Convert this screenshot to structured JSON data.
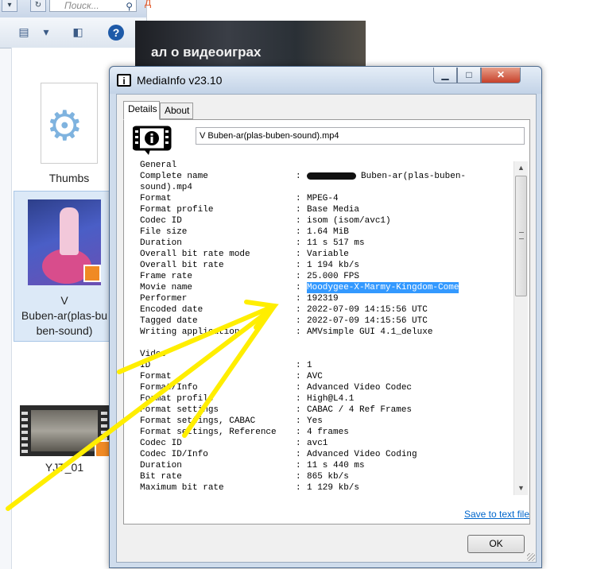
{
  "explorer": {
    "search_placeholder": "Поиск...",
    "files": [
      {
        "label": "Thumbs"
      },
      {
        "label": "V Buben-ar(plas-buben-sound)",
        "line1": "V",
        "line2": "Buben-ar(plas-bu",
        "line3": "ben-sound)"
      },
      {
        "label": "YJT_01"
      }
    ]
  },
  "background": {
    "banner_text": "ал о видеоиграх",
    "red_mark": "д"
  },
  "window": {
    "title": "MediaInfo v23.10",
    "tabs": [
      "Details",
      "About"
    ],
    "file_name": "V Buben-ar(plas-buben-sound).mp4",
    "save_link": "Save to text file",
    "ok_label": "OK"
  },
  "report": {
    "rows": [
      {
        "key": "General",
        "value": null
      },
      {
        "key": "Complete name",
        "value": "Buben-ar(plas-buben-",
        "redacted": true
      },
      {
        "key": "sound).mp4",
        "value": null,
        "continuation": true
      },
      {
        "key": "Format",
        "value": "MPEG-4"
      },
      {
        "key": "Format profile",
        "value": "Base Media"
      },
      {
        "key": "Codec ID",
        "value": "isom (isom/avc1)"
      },
      {
        "key": "File size",
        "value": "1.64 MiB"
      },
      {
        "key": "Duration",
        "value": "11 s 517 ms"
      },
      {
        "key": "Overall bit rate mode",
        "value": "Variable"
      },
      {
        "key": "Overall bit rate",
        "value": "1 194 kb/s"
      },
      {
        "key": "Frame rate",
        "value": "25.000 FPS"
      },
      {
        "key": "Movie name",
        "value": "Moodygee-X-Marmy-Kingdom-Come",
        "highlighted": true
      },
      {
        "key": "Performer",
        "value": "192319"
      },
      {
        "key": "Encoded date",
        "value": "2022-07-09 14:15:56 UTC"
      },
      {
        "key": "Tagged date",
        "value": "2022-07-09 14:15:56 UTC"
      },
      {
        "key": "Writing application",
        "value": "AMVsimple GUI 4.1_deluxe"
      },
      {
        "key": "",
        "value": null,
        "blank": true
      },
      {
        "key": "Video",
        "value": null
      },
      {
        "key": "ID",
        "value": "1"
      },
      {
        "key": "Format",
        "value": "AVC"
      },
      {
        "key": "Format/Info",
        "value": "Advanced Video Codec"
      },
      {
        "key": "Format profile",
        "value": "High@L4.1"
      },
      {
        "key": "Format settings",
        "value": "CABAC / 4 Ref Frames"
      },
      {
        "key": "Format settings, CABAC",
        "value": "Yes"
      },
      {
        "key": "Format settings, Reference",
        "value": "4 frames"
      },
      {
        "key": "Codec ID",
        "value": "avc1"
      },
      {
        "key": "Codec ID/Info",
        "value": "Advanced Video Coding"
      },
      {
        "key": "Duration",
        "value": "11 s 440 ms"
      },
      {
        "key": "Bit rate",
        "value": "865 kb/s"
      },
      {
        "key": "Maximum bit rate",
        "value": "1 129 kb/s"
      }
    ]
  },
  "colors": {
    "annotation": "#ffee00",
    "selection": "#3399ff",
    "link": "#0066cc"
  }
}
